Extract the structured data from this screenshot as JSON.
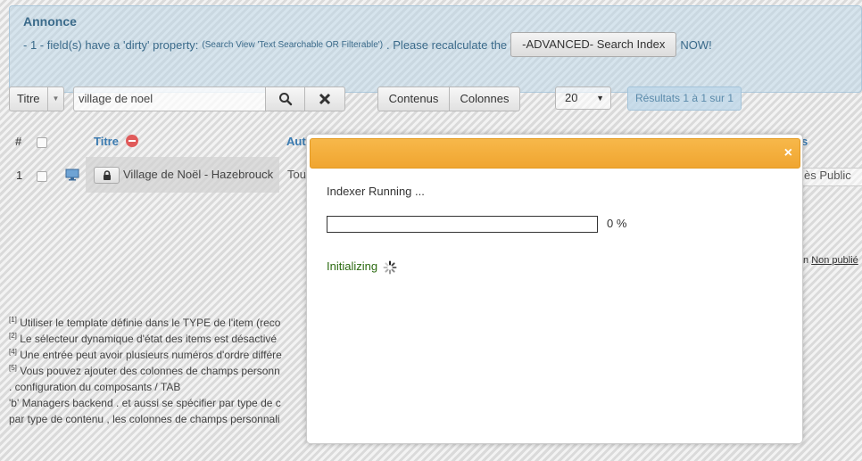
{
  "announce": {
    "title": "Annonce",
    "prefix": "- 1 - field(s) have a 'dirty' property:",
    "detail": "(Search View 'Text Searchable OR Filterable')",
    "middle": ". Please recalculate the",
    "button_label": "-ADVANCED- Search Index",
    "suffix": "NOW!"
  },
  "filters": {
    "field_select": "Titre",
    "search_value": "village de noel",
    "contents_label": "Contenus",
    "columns_label": "Colonnes",
    "per_page": "20",
    "results": "Résultats 1 à 1 sur 1"
  },
  "table": {
    "headers": {
      "num": "#",
      "title": "Titre",
      "author": "Aut",
      "access": "s"
    },
    "rows": [
      {
        "num": "1",
        "title": "Village de Noël - Hazebrouck",
        "author": "Tou",
        "access": "ès Public"
      }
    ]
  },
  "side_text": {
    "prefix": "n",
    "link": "Non publié"
  },
  "footnotes": [
    {
      "mark": "[1]",
      "text": "Utiliser le template définie dans le TYPE de l'item (reco"
    },
    {
      "mark": "[2]",
      "text": "Le sélecteur dynamique d'état des items est désactivé"
    },
    {
      "mark": "[4]",
      "text": "Une entrée peut avoir plusieurs numéros d'ordre différe"
    },
    {
      "mark": "[5]",
      "text": "Vous pouvez ajouter des colonnes de champs personn"
    },
    {
      "mark": "",
      "text": ". configuration du composants / TAB"
    },
    {
      "mark": "",
      "text": "'b' Managers backend . et aussi se spécifier par type de c"
    },
    {
      "mark": "",
      "text": "par type de contenu , les colonnes de champs personnali"
    }
  ],
  "modal": {
    "close": "×",
    "title_text": "Indexer Running ...",
    "progress_percent": 0,
    "progress_label": "0 %",
    "status": "Initializing"
  },
  "colors": {
    "modal_header": "#f0a530",
    "status_text": "#2b6a10",
    "link_blue": "#3a7ab0"
  }
}
